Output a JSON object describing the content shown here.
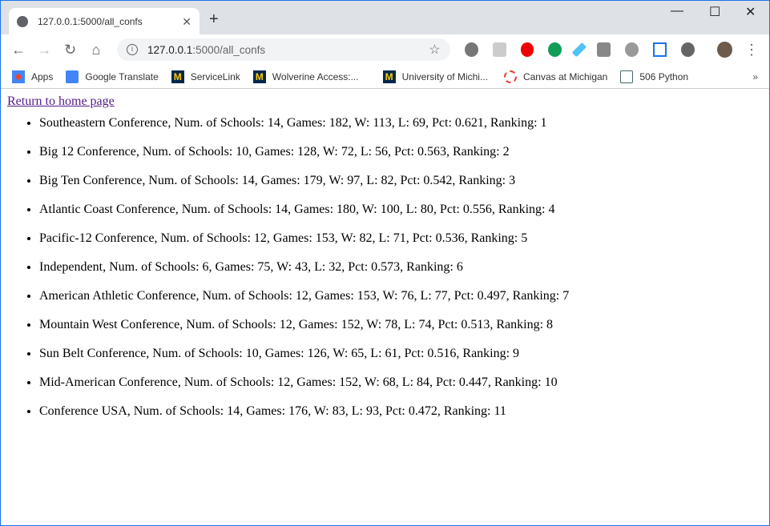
{
  "browser": {
    "tab_title": "127.0.0.1:5000/all_confs",
    "url_host": "127.0.0.1",
    "url_rest": ":5000/all_confs",
    "bookmarks": [
      "Apps",
      "Google Translate",
      "ServiceLink",
      "Wolverine Access:...",
      "University of Michi...",
      "Canvas at Michigan",
      "506 Python"
    ]
  },
  "page": {
    "home_link": "Return to home page",
    "conferences": [
      "Southeastern Conference, Num. of Schools: 14, Games: 182, W: 113, L: 69, Pct: 0.621, Ranking: 1",
      "Big 12 Conference, Num. of Schools: 10, Games: 128, W: 72, L: 56, Pct: 0.563, Ranking: 2",
      "Big Ten Conference, Num. of Schools: 14, Games: 179, W: 97, L: 82, Pct: 0.542, Ranking: 3",
      "Atlantic Coast Conference, Num. of Schools: 14, Games: 180, W: 100, L: 80, Pct: 0.556, Ranking: 4",
      "Pacific-12 Conference, Num. of Schools: 12, Games: 153, W: 82, L: 71, Pct: 0.536, Ranking: 5",
      "Independent, Num. of Schools: 6, Games: 75, W: 43, L: 32, Pct: 0.573, Ranking: 6",
      "American Athletic Conference, Num. of Schools: 12, Games: 153, W: 76, L: 77, Pct: 0.497, Ranking: 7",
      "Mountain West Conference, Num. of Schools: 12, Games: 152, W: 78, L: 74, Pct: 0.513, Ranking: 8",
      "Sun Belt Conference, Num. of Schools: 10, Games: 126, W: 65, L: 61, Pct: 0.516, Ranking: 9",
      "Mid-American Conference, Num. of Schools: 12, Games: 152, W: 68, L: 84, Pct: 0.447, Ranking: 10",
      "Conference USA, Num. of Schools: 14, Games: 176, W: 83, L: 93, Pct: 0.472, Ranking: 11"
    ]
  }
}
